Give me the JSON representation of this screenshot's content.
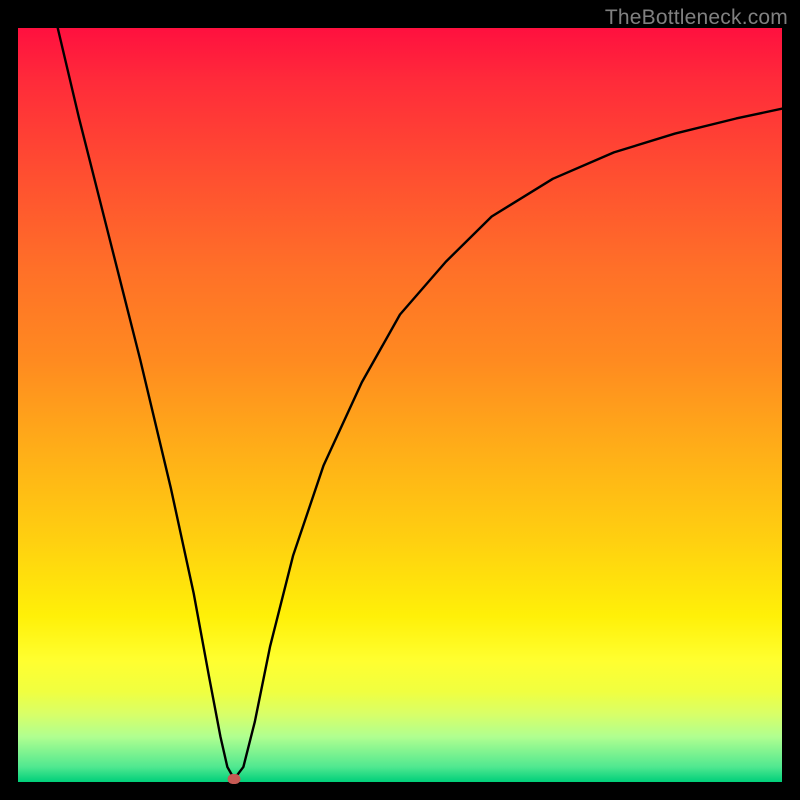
{
  "watermark": "TheBottleneck.com",
  "chart_data": {
    "type": "line",
    "title": "",
    "xlabel": "",
    "ylabel": "",
    "xlim": [
      0,
      100
    ],
    "ylim": [
      0,
      100
    ],
    "series": [
      {
        "name": "bottleneck-curve",
        "x": [
          5.2,
          8,
          12,
          16,
          20,
          23,
          25,
          26.5,
          27.4,
          28.3,
          29.5,
          31,
          33,
          36,
          40,
          45,
          50,
          56,
          62,
          70,
          78,
          86,
          94,
          100
        ],
        "values": [
          100,
          88,
          72,
          56,
          39,
          25,
          14,
          6,
          2,
          0.4,
          2,
          8,
          18,
          30,
          42,
          53,
          62,
          69,
          75,
          80,
          83.5,
          86,
          88,
          89.3
        ]
      }
    ],
    "marker": {
      "x": 28.3,
      "y": 0.4
    },
    "grid": false,
    "legend": false,
    "background": "vertical-gradient-red-to-green",
    "annotations": []
  },
  "frame": {
    "xpx": 18,
    "ypx": 28,
    "wpx": 764,
    "hpx": 754
  }
}
